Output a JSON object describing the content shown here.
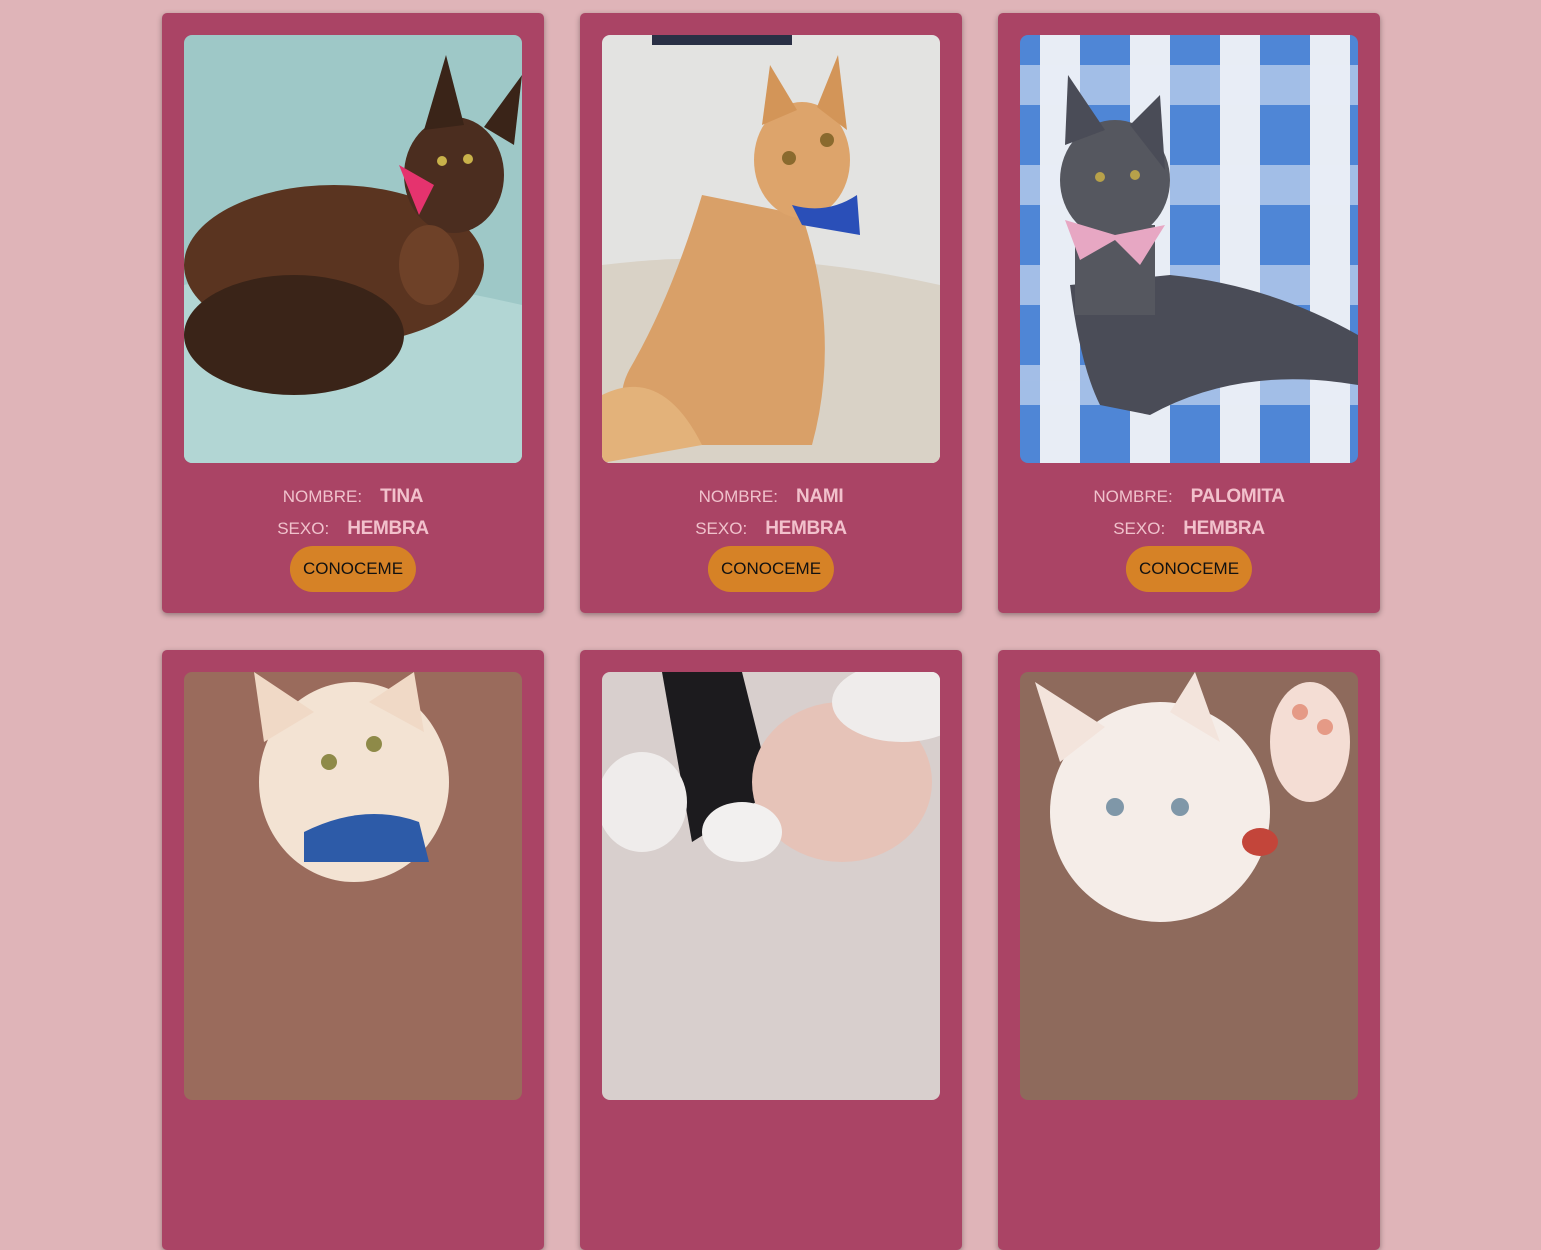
{
  "labels": {
    "nombre": "NOMBRE:",
    "sexo": "SEXO:",
    "button": "CONOCEME"
  },
  "cats": [
    {
      "nombre": "TINA",
      "sexo": "HEMBRA",
      "photo": "tortoiseshell-cat"
    },
    {
      "nombre": "NAMI",
      "sexo": "HEMBRA",
      "photo": "orange-kitten"
    },
    {
      "nombre": "PALOMITA",
      "sexo": "HEMBRA",
      "photo": "gray-cat"
    },
    {
      "photo": "cream-kitten"
    },
    {
      "photo": "white-black-kitten"
    },
    {
      "photo": "white-kitten"
    }
  ],
  "colors": {
    "background": "#dfb4b8",
    "card": "#aa4465",
    "button": "#d68226",
    "text": "#f2c1cc"
  }
}
